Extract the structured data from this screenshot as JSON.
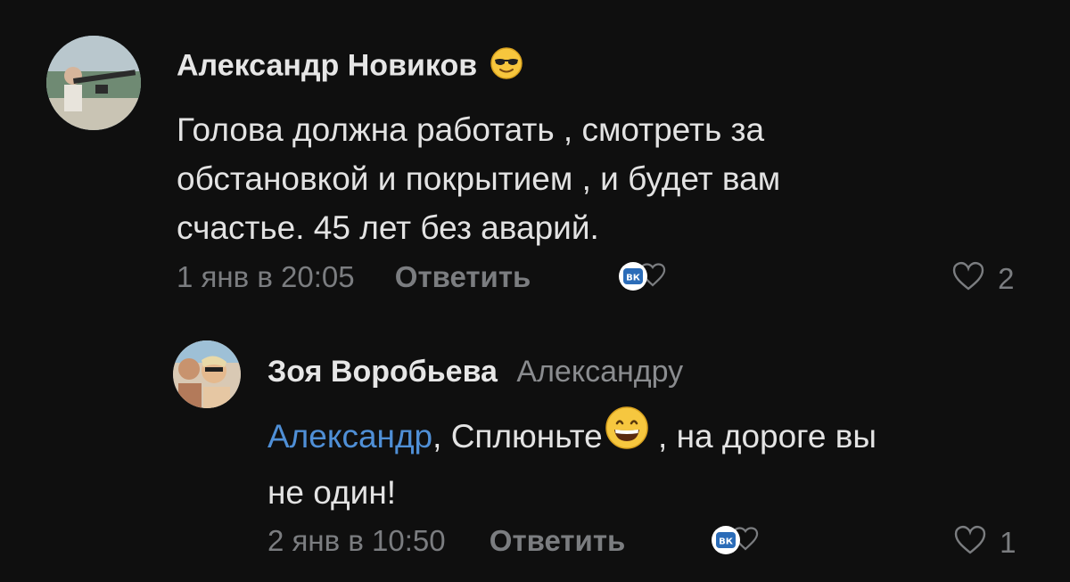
{
  "comments": [
    {
      "author": "Александр Новиков",
      "author_emoji": "smiling-face-with-sunglasses",
      "text_lines": [
        "Голова должна работать , смотреть за",
        "обстановкой и покрытием , и будет вам",
        "счастье. 45 лет без аварий."
      ],
      "date": "1 янв в 20:05",
      "reply_label": "Ответить",
      "likes": "2"
    },
    {
      "author": "Зоя Воробьева",
      "reply_to": "Александру",
      "mention": "Александр",
      "text_after_mention": ", Сплюньте",
      "text_after_emoji": " , на дороге вы",
      "text_line_2": "не один!",
      "inline_emoji": "grinning-face-with-smiling-eyes",
      "date": "2 янв в 10:50",
      "reply_label": "Ответить",
      "likes": "1"
    }
  ],
  "colors": {
    "background": "#0f0f0f",
    "text": "#e3e3e3",
    "meta": "#7b7d80",
    "mention": "#4f8fd6",
    "vk_blue": "#2b6cb8"
  }
}
